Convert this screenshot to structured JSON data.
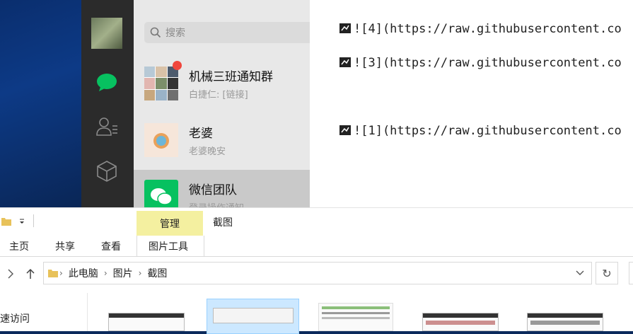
{
  "wechat": {
    "search_placeholder": "搜索",
    "chats": [
      {
        "name": "机械三班通知群",
        "message": "白捷仁: [链接]",
        "unread": true
      },
      {
        "name": "老婆",
        "message": "老婆晚安",
        "unread": false
      },
      {
        "name": "微信团队",
        "message": "登录操作通知",
        "unread": false
      }
    ],
    "colors": {
      "accent": "#07c160",
      "sidebar": "#2b2b2b",
      "list_bg": "#e8e8e8"
    }
  },
  "editor": {
    "lines": [
      "![4](https://raw.githubusercontent.co",
      "![3](https://raw.githubusercontent.co",
      "![1](https://raw.githubusercontent.co"
    ]
  },
  "explorer": {
    "context_group": "管理",
    "window_title": "截图",
    "tabs": {
      "home": "主页",
      "share": "共享",
      "view": "查看",
      "picture_tools": "图片工具"
    },
    "breadcrumbs": [
      "此电脑",
      "图片",
      "截图"
    ],
    "quick_access": "速访问"
  }
}
